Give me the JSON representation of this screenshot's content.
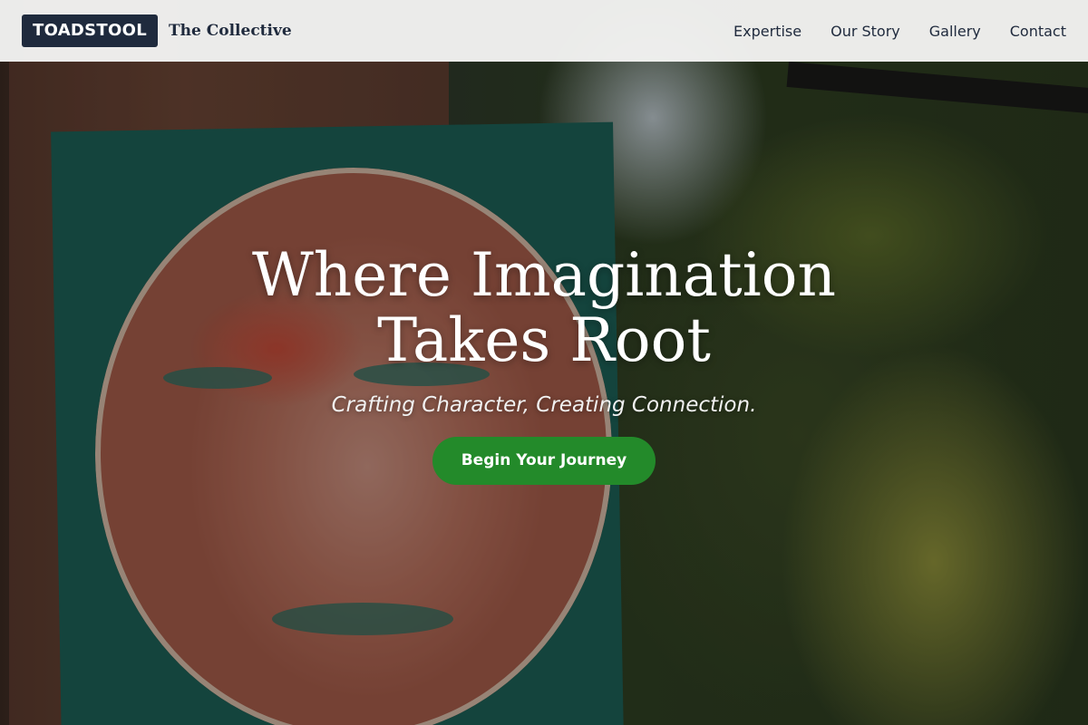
{
  "header": {
    "logo_text": "TOADSTOOL",
    "brand_name": "The Collective",
    "nav": [
      {
        "label": "Expertise"
      },
      {
        "label": "Our Story"
      },
      {
        "label": "Gallery"
      },
      {
        "label": "Contact"
      }
    ]
  },
  "hero": {
    "title": "Where Imagination Takes Root",
    "subtitle": "Crafting Character, Creating Connection.",
    "cta_label": "Begin Your Journey"
  },
  "colors": {
    "header_bg": "#f4f4f2",
    "logo_bg": "#1f2a3d",
    "text_dark": "#1f2a3d",
    "cta_bg": "#238a2a",
    "hero_text": "#ffffff"
  }
}
